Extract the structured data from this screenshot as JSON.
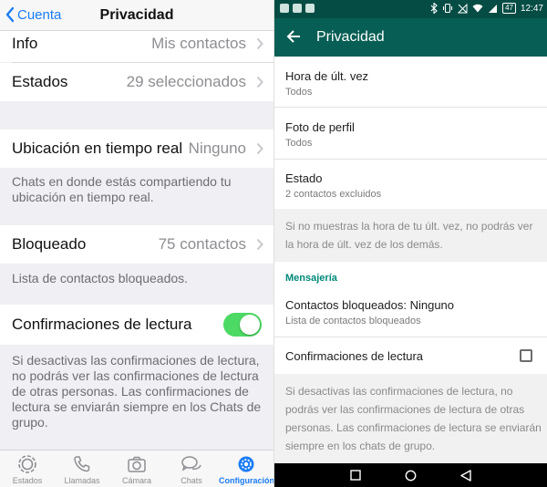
{
  "ios": {
    "nav": {
      "back_label": "Cuenta",
      "title": "Privacidad"
    },
    "rows": {
      "info": {
        "label": "Info",
        "value": "Mis contactos"
      },
      "estados": {
        "label": "Estados",
        "value": "29 seleccionados"
      },
      "ubicacion": {
        "label": "Ubicación en tiempo real",
        "value": "Ninguno",
        "note": "Chats en donde estás compartiendo tu ubicación en tiempo real."
      },
      "bloqueado": {
        "label": "Bloqueado",
        "value": "75 contactos",
        "note": "Lista de contactos bloqueados."
      },
      "confirmaciones": {
        "label": "Confirmaciones de lectura",
        "enabled": true,
        "note": "Si desactivas las confirmaciones de lectura, no podrás ver las confirmaciones de lectura de otras personas. Las confirmaciones de lectura se enviarán siempre en los Chats de grupo."
      }
    },
    "tabs": [
      {
        "label": "Estados",
        "icon": "status-icon"
      },
      {
        "label": "Llamadas",
        "icon": "phone-icon"
      },
      {
        "label": "Cámara",
        "icon": "camera-icon"
      },
      {
        "label": "Chats",
        "icon": "chats-icon"
      },
      {
        "label": "Configuración",
        "icon": "gear-icon",
        "active": true
      }
    ],
    "colors": {
      "accent": "#1a7cf5",
      "toggle_on": "#4cd964"
    }
  },
  "android": {
    "status_bar": {
      "time": "12:47",
      "battery": "47"
    },
    "toolbar": {
      "title": "Privacidad"
    },
    "items": {
      "hora": {
        "title": "Hora de últ. vez",
        "value": "Todos"
      },
      "foto": {
        "title": "Foto de perfil",
        "value": "Todos"
      },
      "estado": {
        "title": "Estado",
        "value": "2 contactos excluidos"
      }
    },
    "note_hora": "Si no muestras la hora de tu últ. vez, no podrás ver la hora de últ. vez de los demás.",
    "section_mensajeria": "Mensajería",
    "bloqueados": {
      "title": "Contactos bloqueados: Ninguno",
      "value": "Lista de contactos bloqueados"
    },
    "confirmaciones": {
      "title": "Confirmaciones de lectura",
      "checked": false
    },
    "note_confirmaciones": "Si desactivas las confirmaciones de lectura, no podrás ver las confirmaciones de lectura de otras personas. Las confirmaciones de lectura se enviarán siempre en los chats de grupo.",
    "colors": {
      "toolbar": "#075e54",
      "status_bar": "#054d44",
      "section": "#00897b"
    }
  }
}
